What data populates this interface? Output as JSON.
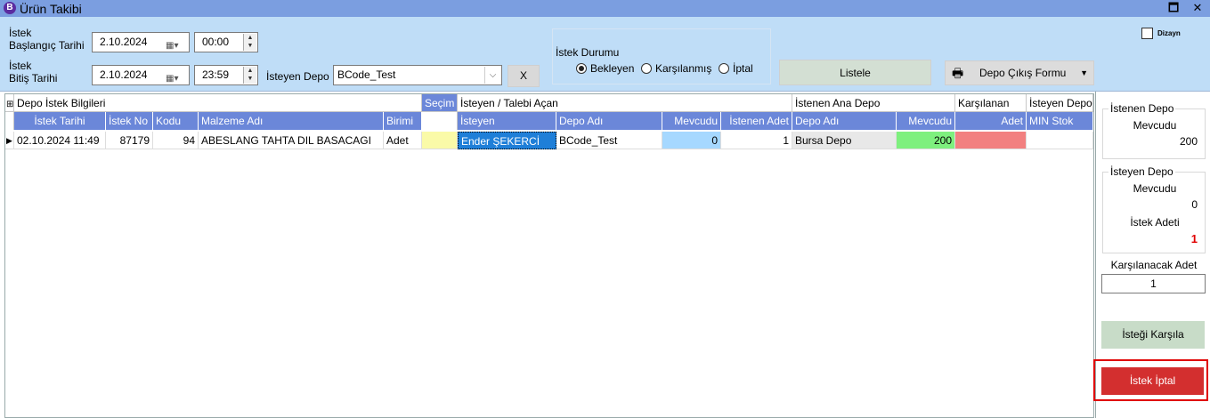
{
  "window": {
    "title": "Ürün Takibi",
    "icon_letter": "B",
    "minimize_glyph": "🗖",
    "close_glyph": "✕"
  },
  "filters": {
    "start_label_line1": "İstek",
    "start_label_line2": "Başlangıç Tarihi",
    "start_date": "2.10.2024",
    "start_time": "00:00",
    "end_label_line1": "İstek",
    "end_label_line2": "Bitiş Tarihi",
    "end_date": "2.10.2024",
    "end_time": "23:59",
    "depot_label": "İsteyen Depo",
    "depot_value": "BCode_Test",
    "clear_button": "X",
    "status_label": "İstek Durumu",
    "status_options": [
      "Bekleyen",
      "Karşılanmış",
      "İptal"
    ],
    "status_selected": "Bekleyen",
    "list_button": "Listele",
    "print_button": "Depo Çıkış Formu",
    "design_checkbox_label": "Dizayn",
    "design_checked": false
  },
  "grid": {
    "bands": [
      "Depo İstek Bilgileri",
      "Seçim",
      "İsteyen / Talebi Açan",
      "İstenen Ana Depo",
      "Karşılanan",
      "İsteyen Depo"
    ],
    "columns": [
      "İstek Tarihi",
      "İstek No",
      "Kodu",
      "Malzeme Adı",
      "Birimi",
      "İsteyen",
      "Depo Adı",
      "Mevcudu",
      "İstenen Adet",
      "Depo Adı",
      "Mevcudu",
      "Adet",
      "MIN Stok"
    ],
    "rows": [
      {
        "istek_tarihi": "02.10.2024 11:49",
        "istek_no": "87179",
        "kodu": "94",
        "malzeme_adi": "ABESLANG TAHTA DIL BASACAGI",
        "birimi": "Adet",
        "isteyen": "Ender ŞEKERCİ",
        "depo_adi": "BCode_Test",
        "mevcudu": "0",
        "istenen_adet": "1",
        "ana_depo_adi": "Bursa Depo",
        "ana_depo_mevcudu": "200",
        "karsilanan_adet": "",
        "min_stok": ""
      }
    ]
  },
  "side_panel": {
    "requested_depot_title": "İstenen Depo",
    "requested_depot_stock_label": "Mevcudu",
    "requested_depot_stock": "200",
    "requesting_depot_title": "İsteyen Depo",
    "requesting_depot_stock_label": "Mevcudu",
    "requesting_depot_stock": "0",
    "request_qty_label": "İstek Adeti",
    "request_qty": "1",
    "to_fulfill_label": "Karşılanacak Adet",
    "to_fulfill_value": "1",
    "fulfill_button": "İsteği Karşıla",
    "cancel_button": "İstek İptal"
  },
  "colors": {
    "title_bar": "#7b9ee0",
    "filter_panel": "#bfddf7",
    "column_header": "#6b87d9",
    "selected_cell": "#1f7fd8",
    "stock_blue": "#a6d8ff",
    "stock_green": "#7ef07e",
    "fulfilled_red": "#f28080",
    "selection_yellow": "#fafaa8",
    "cancel_red": "#d32f2f"
  }
}
